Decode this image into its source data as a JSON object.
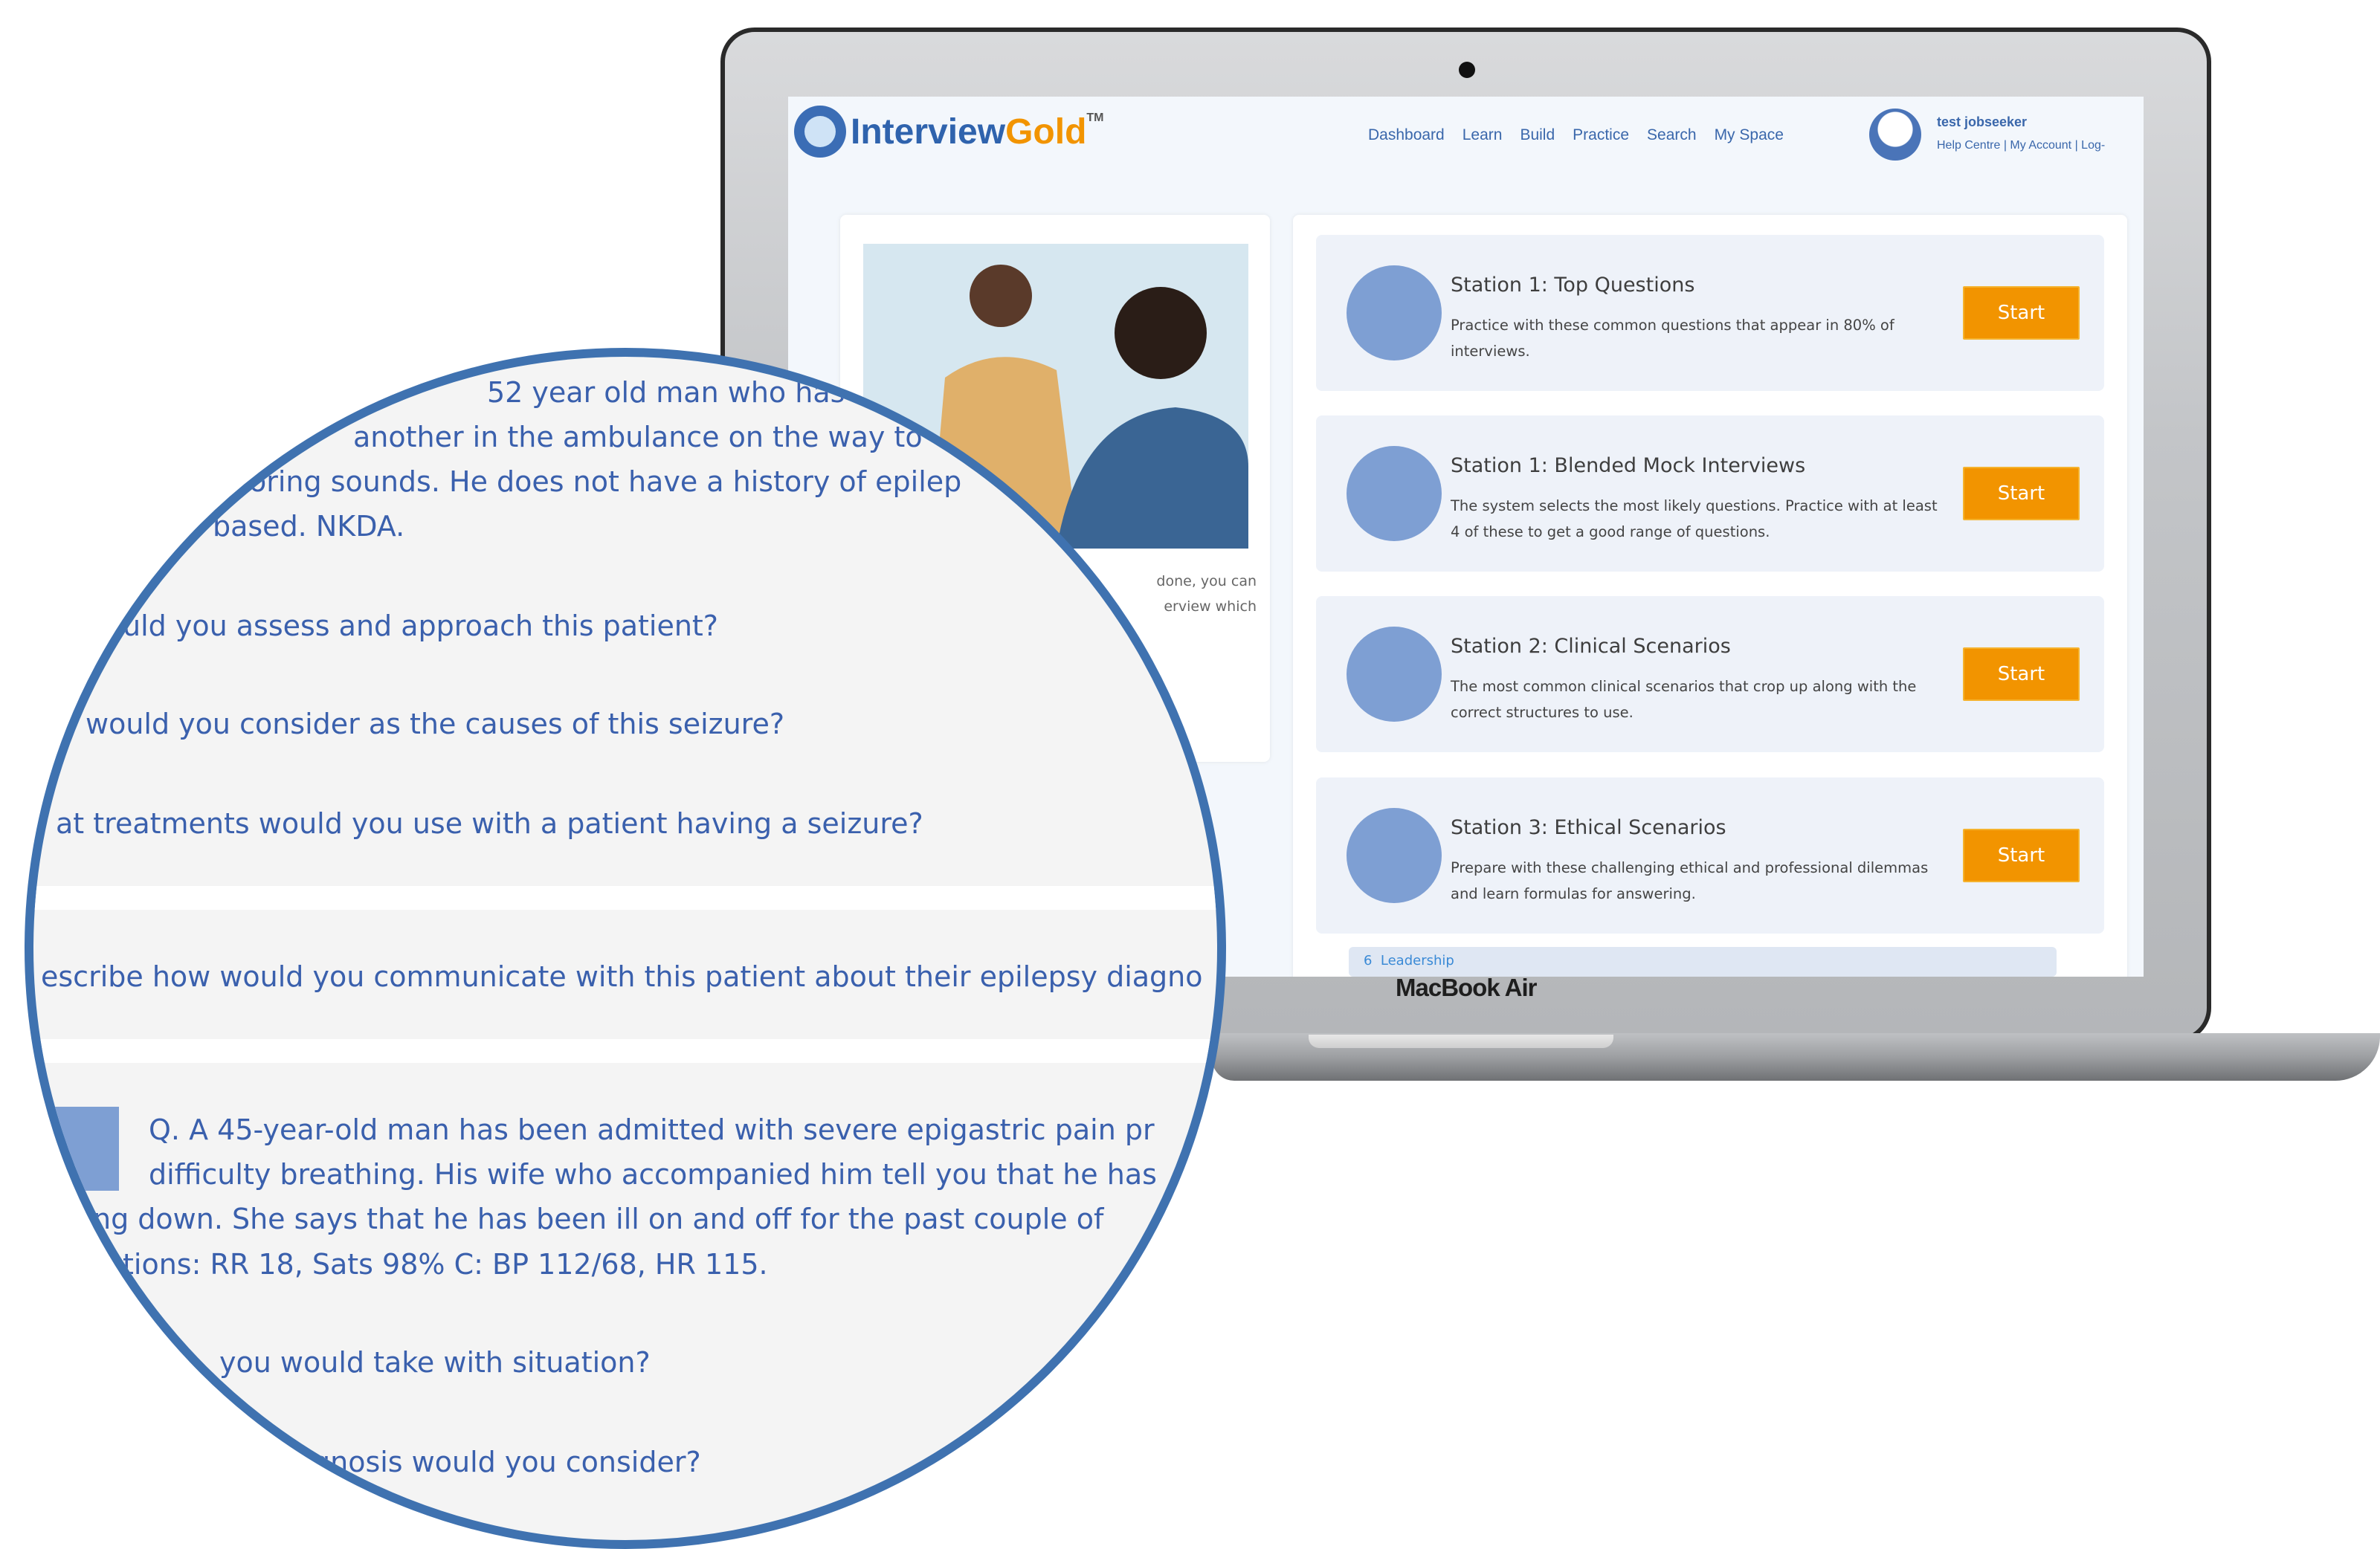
{
  "app": {
    "logo_primary": "Interview",
    "logo_accent": "Gold",
    "logo_tm": "TM"
  },
  "nav": {
    "items": [
      "Dashboard",
      "Learn",
      "Build",
      "Practice",
      "Search",
      "My Space"
    ]
  },
  "user": {
    "name": "test jobseeker",
    "links": "Help Centre | My Account | Log-"
  },
  "left_card": {
    "text_lines": [
      "done, you can",
      "erview which"
    ]
  },
  "stations": [
    {
      "title": "Station 1: Top Questions",
      "description": "Practice with these common questions that appear in 80% of interviews.",
      "button": "Start",
      "icon": "person-speech-bubble-icon"
    },
    {
      "title": "Station 1: Blended Mock Interviews",
      "description": "The system selects the most likely questions. Practice with at least 4 of these to get a good range of questions.",
      "button": "Start",
      "icon": "chat-bubbles-icon"
    },
    {
      "title": "Station 2: Clinical Scenarios",
      "description": "The most common clinical scenarios that crop up along with the correct structures to use.",
      "button": "Start",
      "icon": "person-speech-bubble-icon"
    },
    {
      "title": "Station 3: Ethical Scenarios",
      "description": "Prepare with these challenging ethical and professional dilemmas and learn formulas for answering.",
      "button": "Start",
      "icon": "person-speech-bubble-icon"
    }
  ],
  "next_item": "6  Leadership",
  "device_label": "MacBook Air",
  "magnifier": {
    "lines": [
      "52 year old man who has",
      "another in the ambulance on the way to",
      "oring sounds. He does not have a history of epilep",
      "ter based. NKDA.",
      "uld you assess and approach this patient?",
      "would you consider as the causes of this seizure?",
      "at treatments would you use with a patient having a seizure?",
      "escribe how would you communicate with this patient about their epilepsy diagno",
      "Q. A 45-year-old man has been admitted with severe epigastric pain pr",
      "difficulty breathing. His wife who accompanied him tell you that he has",
      "ng down. She says that he has been ill on and off for the past couple of",
      "tions: RR 18, Sats 98% C: BP 112/68, HR 115.",
      "you would take with situation?",
      "gnosis would you consider?"
    ]
  },
  "colors": {
    "accent": "#f29400",
    "brand_blue": "#3a67ab",
    "icon_blue": "#7e9fd3",
    "magnifier_border": "#3f72b0",
    "question_text": "#3a60ad"
  }
}
